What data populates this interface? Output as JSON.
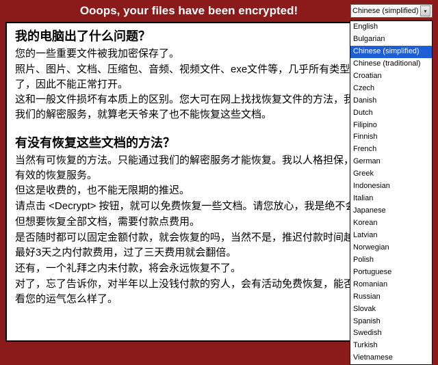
{
  "header": {
    "title": "Ooops, your files have been encrypted!",
    "selected_language": "Chinese (simplified)"
  },
  "languages": [
    "English",
    "Bulgarian",
    "Chinese (simplified)",
    "Chinese (traditional)",
    "Croatian",
    "Czech",
    "Danish",
    "Dutch",
    "Filipino",
    "Finnish",
    "French",
    "German",
    "Greek",
    "Indonesian",
    "Italian",
    "Japanese",
    "Korean",
    "Latvian",
    "Norwegian",
    "Polish",
    "Portuguese",
    "Romanian",
    "Russian",
    "Slovak",
    "Spanish",
    "Swedish",
    "Turkish",
    "Vietnamese"
  ],
  "selected_language_index": 2,
  "body": {
    "h1": "我的电脑出了什么问题？",
    "p1": "您的一些重要文件被我加密保存了。",
    "p2": "照片、图片、文档、压缩包、音频、视频文件、exe文件等，几乎所有类型的文件都被加密了，因此不能正常打开。",
    "p3": "这和一般文件损坏有本质上的区别。您大可在网上找找恢复文件的方法，我敢保证，没有我们的解密服务，就算老天爷来了也不能恢复这些文档。",
    "h2": "有没有恢复这些文档的方法？",
    "p4": "当然有可恢复的方法。只能通过我们的解密服务才能恢复。我以人格担保，能够提供安全有效的恢复服务。",
    "p5": "但这是收费的，也不能无限期的推迟。",
    "p6": "请点击 <Decrypt> 按钮，就可以免费恢复一些文档。请您放心，我是绝不会骗你的。",
    "p7": "但想要恢复全部文档，需要付款点费用。",
    "p8": "是否随时都可以固定金额付款，就会恢复的吗，当然不是，推迟付款时间越长对你不利。",
    "p9": "最好3天之内付款费用，过了三天费用就会翻倍。",
    "p10": "还有，一个礼拜之内未付款，将会永远恢复不了。",
    "p11": "对了，忘了告诉你，对半年以上没钱付款的穷人，会有活动免费恢复，能否轮到你，就要看您的运气怎么样了。"
  }
}
